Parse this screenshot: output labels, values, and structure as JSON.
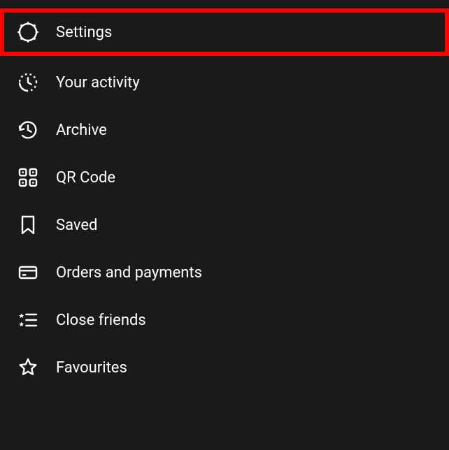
{
  "menu": {
    "items": [
      {
        "label": "Settings",
        "highlighted": true
      },
      {
        "label": "Your activity"
      },
      {
        "label": "Archive"
      },
      {
        "label": "QR Code"
      },
      {
        "label": "Saved"
      },
      {
        "label": "Orders and payments"
      },
      {
        "label": "Close friends"
      },
      {
        "label": "Favourites"
      }
    ]
  }
}
